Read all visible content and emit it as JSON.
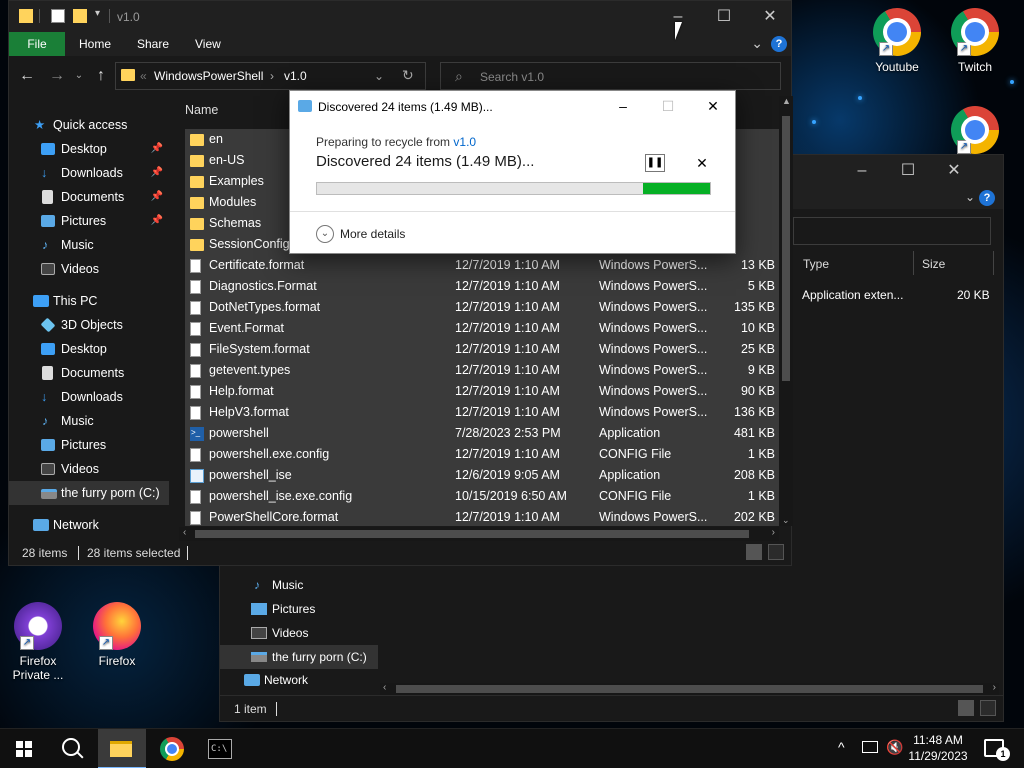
{
  "desktop": {
    "icons": [
      {
        "label": "Youtube"
      },
      {
        "label": "Twitch"
      },
      {
        "label": ""
      },
      {
        "label": "Firefox Private ..."
      },
      {
        "label": "Firefox"
      }
    ]
  },
  "back_window": {
    "column_type": "Type",
    "column_size": "Size",
    "row_type": "Application exten...",
    "row_size": "20 KB",
    "nav": [
      {
        "label": "Music"
      },
      {
        "label": "Pictures"
      },
      {
        "label": "Videos"
      },
      {
        "label": "the furry porn (C:)"
      },
      {
        "label": "Network"
      }
    ],
    "status": "1 item"
  },
  "explorer": {
    "title": "v1.0",
    "tabs": {
      "file": "File",
      "home": "Home",
      "share": "Share",
      "view": "View"
    },
    "help": "?",
    "address": {
      "crumb1": "WindowsPowerShell",
      "crumb2": "v1.0",
      "overflow": "«"
    },
    "search_placeholder": "Search v1.0",
    "sidebar": {
      "quick_access": "Quick access",
      "qa_items": [
        {
          "label": "Desktop"
        },
        {
          "label": "Downloads"
        },
        {
          "label": "Documents"
        },
        {
          "label": "Pictures"
        },
        {
          "label": "Music"
        },
        {
          "label": "Videos"
        }
      ],
      "this_pc": "This PC",
      "pc_items": [
        {
          "label": "3D Objects"
        },
        {
          "label": "Desktop"
        },
        {
          "label": "Documents"
        },
        {
          "label": "Downloads"
        },
        {
          "label": "Music"
        },
        {
          "label": "Pictures"
        },
        {
          "label": "Videos"
        },
        {
          "label": "the furry porn (C:)"
        }
      ],
      "network": "Network"
    },
    "column_name": "Name",
    "rows": [
      {
        "name": "en",
        "date": "",
        "type": "",
        "size": "",
        "icon": "folder"
      },
      {
        "name": "en-US",
        "date": "",
        "type": "",
        "size": "",
        "icon": "folder"
      },
      {
        "name": "Examples",
        "date": "",
        "type": "",
        "size": "",
        "icon": "folder"
      },
      {
        "name": "Modules",
        "date": "",
        "type": "",
        "size": "",
        "icon": "folder"
      },
      {
        "name": "Schemas",
        "date": "",
        "type": "",
        "size": "",
        "icon": "folder"
      },
      {
        "name": "SessionConfig",
        "date": "",
        "type": "",
        "size": "",
        "icon": "folder"
      },
      {
        "name": "Certificate.format",
        "date": "12/7/2019 1:10 AM",
        "type": "Windows PowerS...",
        "size": "13 KB",
        "icon": "file"
      },
      {
        "name": "Diagnostics.Format",
        "date": "12/7/2019 1:10 AM",
        "type": "Windows PowerS...",
        "size": "5 KB",
        "icon": "file"
      },
      {
        "name": "DotNetTypes.format",
        "date": "12/7/2019 1:10 AM",
        "type": "Windows PowerS...",
        "size": "135 KB",
        "icon": "file"
      },
      {
        "name": "Event.Format",
        "date": "12/7/2019 1:10 AM",
        "type": "Windows PowerS...",
        "size": "10 KB",
        "icon": "file"
      },
      {
        "name": "FileSystem.format",
        "date": "12/7/2019 1:10 AM",
        "type": "Windows PowerS...",
        "size": "25 KB",
        "icon": "file"
      },
      {
        "name": "getevent.types",
        "date": "12/7/2019 1:10 AM",
        "type": "Windows PowerS...",
        "size": "9 KB",
        "icon": "file"
      },
      {
        "name": "Help.format",
        "date": "12/7/2019 1:10 AM",
        "type": "Windows PowerS...",
        "size": "90 KB",
        "icon": "file"
      },
      {
        "name": "HelpV3.format",
        "date": "12/7/2019 1:10 AM",
        "type": "Windows PowerS...",
        "size": "136 KB",
        "icon": "file"
      },
      {
        "name": "powershell",
        "date": "7/28/2023 2:53 PM",
        "type": "Application",
        "size": "481 KB",
        "icon": "powershell"
      },
      {
        "name": "powershell.exe.config",
        "date": "12/7/2019 1:10 AM",
        "type": "CONFIG File",
        "size": "1 KB",
        "icon": "file"
      },
      {
        "name": "powershell_ise",
        "date": "12/6/2019 9:05 AM",
        "type": "Application",
        "size": "208 KB",
        "icon": "powershell-ise"
      },
      {
        "name": "powershell_ise.exe.config",
        "date": "10/15/2019 6:50 AM",
        "type": "CONFIG File",
        "size": "1 KB",
        "icon": "file"
      },
      {
        "name": "PowerShellCore.format",
        "date": "12/7/2019 1:10 AM",
        "type": "Windows PowerS...",
        "size": "202 KB",
        "icon": "file"
      }
    ],
    "status_items": "28 items",
    "status_selected": "28 items selected"
  },
  "dialog": {
    "title": "Discovered 24 items (1.49 MB)...",
    "preparing_prefix": "Preparing to recycle from ",
    "preparing_link": "v1.0",
    "headline": "Discovered 24 items (1.49 MB)...",
    "more_details": "More details",
    "progress_start_fraction": 0.83,
    "progress_end_fraction": 1.0,
    "progress_color": "#06b025"
  },
  "taskbar": {
    "clock_time": "11:48 AM",
    "clock_date": "11/29/2023",
    "notification_count": "1"
  },
  "colors": {
    "ribbon_file_tab": "#1a7f37",
    "selection": "#3a3a3a",
    "accent": "#1e73d6"
  }
}
